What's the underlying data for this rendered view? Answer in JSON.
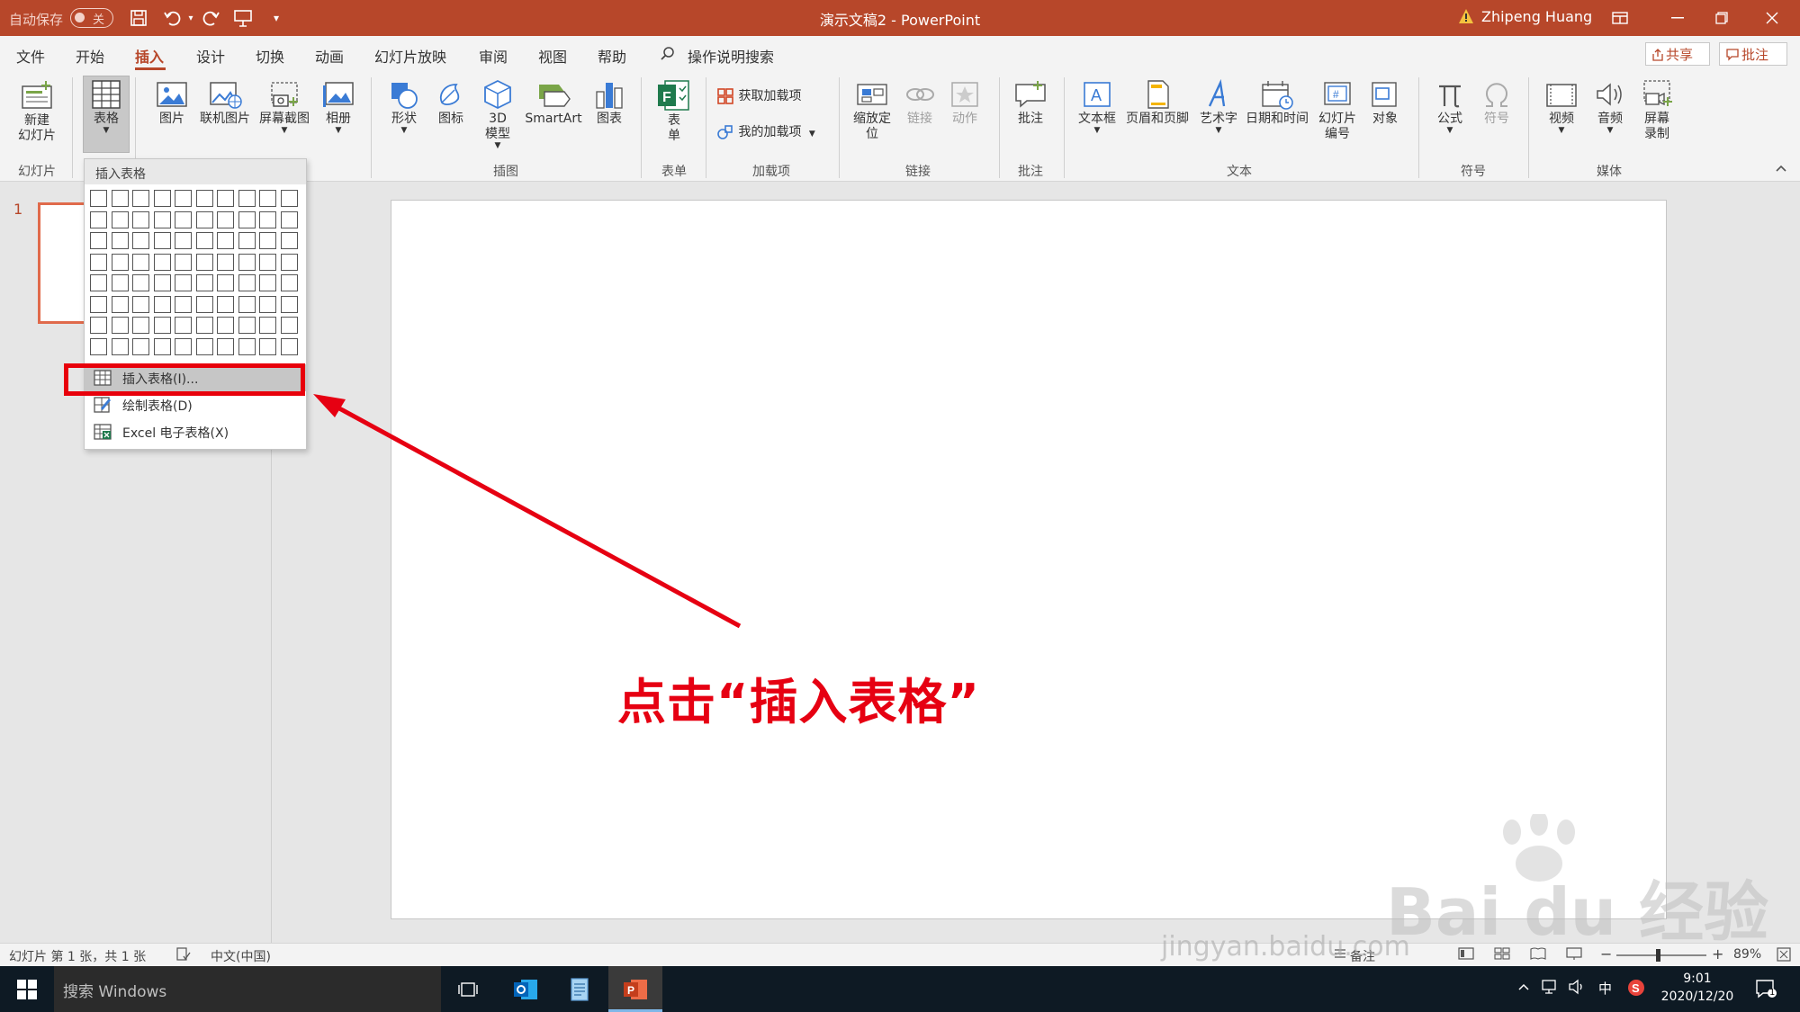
{
  "titlebar": {
    "autosave_label": "自动保存",
    "autosave_state": "关",
    "document_title": "演示文稿2  -  PowerPoint",
    "user_name": "Zhipeng Huang"
  },
  "menu": {
    "tabs": [
      "文件",
      "开始",
      "插入",
      "设计",
      "切换",
      "动画",
      "幻灯片放映",
      "审阅",
      "视图",
      "帮助"
    ],
    "active_tab": "插入",
    "search_label": "操作说明搜索",
    "share_label": "共享",
    "comment_label": "批注"
  },
  "ribbon": {
    "new_slide": "新建\n幻灯片",
    "table": "表格",
    "picture": "图片",
    "online_picture": "联机图片",
    "screenshot": "屏幕截图",
    "album": "相册",
    "shapes": "形状",
    "icons": "图标",
    "model_3d": "3D\n模型",
    "smartart": "SmartArt",
    "chart": "图表",
    "forms": "表\n单",
    "get_addins": "获取加载项",
    "my_addins": "我的加载项",
    "zoom": "缩放定\n位",
    "link": "链接",
    "action": "动作",
    "comment": "批注",
    "textbox": "文本框",
    "header_footer": "页眉和页脚",
    "wordart": "艺术字",
    "datetime": "日期和时间",
    "slide_number": "幻灯片\n编号",
    "object": "对象",
    "equation": "公式",
    "symbol": "符号",
    "video": "视频",
    "audio": "音频",
    "screen_record": "屏幕\n录制",
    "groups": {
      "slides": "幻灯片",
      "images": "插图",
      "forms": "表单",
      "addins": "加载项",
      "links": "链接",
      "comments": "批注",
      "text": "文本",
      "symbols": "符号",
      "media": "媒体"
    }
  },
  "dropdown": {
    "title": "插入表格",
    "grid_cols": 10,
    "grid_rows": 8,
    "items": [
      "插入表格(I)...",
      "绘制表格(D)",
      "Excel 电子表格(X)"
    ]
  },
  "slides_panel": {
    "slide_number": "1"
  },
  "annotation": "点击“插入表格”",
  "statusbar": {
    "slide_info": "幻灯片 第 1 张，共 1 张",
    "language": "中文(中国)",
    "notes": "备注",
    "zoom": "89%"
  },
  "watermark": {
    "main": "Bai du 经验",
    "sub": "jingyan.baidu.com"
  },
  "taskbar": {
    "search_placeholder": "搜索 Windows",
    "ime": "中",
    "time": "9:01",
    "date": "2020/12/20",
    "notification_count": "1"
  },
  "colors": {
    "accent": "#b7472a",
    "annotation": "#e60012"
  }
}
